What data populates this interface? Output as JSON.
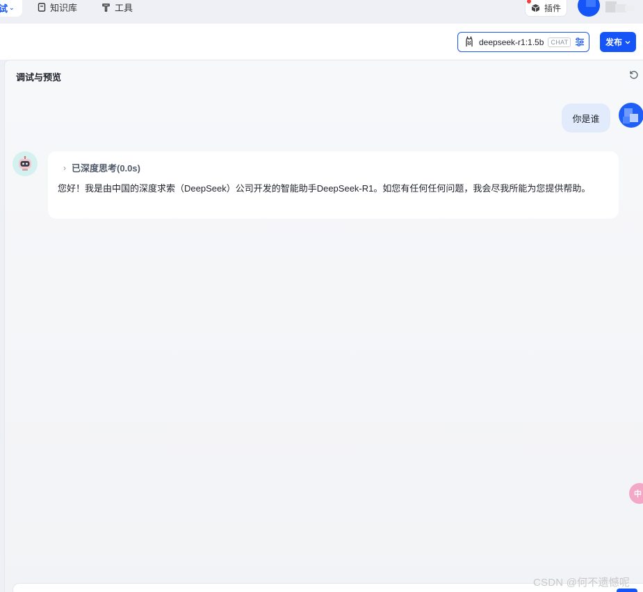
{
  "nav": {
    "active_tab": "试",
    "knowledge_base": "知识库",
    "tools": "工具",
    "plugin": "插件"
  },
  "toolbar": {
    "model_name": "deepseek-r1:1.5b",
    "model_tag": "CHAT",
    "publish": "发布"
  },
  "panel": {
    "title": "调试与预览"
  },
  "chat": {
    "user_message": "你是谁",
    "thinking_label": "已深度思考(0.0s)",
    "bot_reply": "您好！我是由中国的深度求索（DeepSeek）公司开发的智能助手DeepSeek-R1。如您有任何任何问题，我会尽我所能为您提供帮助。"
  },
  "floating": {
    "label": "中"
  },
  "watermark": "CSDN @何不遗憾呢",
  "colors": {
    "primary": "#1554f6",
    "user_bubble": "#e2ebfb",
    "bot_avatar_bg": "#d5f1ef"
  }
}
